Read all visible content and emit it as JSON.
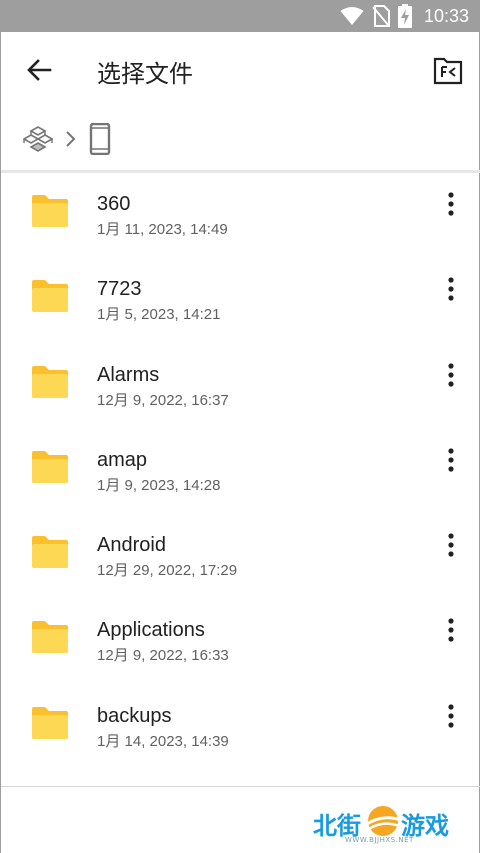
{
  "status_bar": {
    "time": "10:33",
    "icons": [
      "wifi-icon",
      "no-sim-icon",
      "battery-charging-icon"
    ]
  },
  "toolbar": {
    "back_icon": "arrow-back-icon",
    "title": "选择文件",
    "action_icon": "folder-select-icon"
  },
  "breadcrumb": {
    "items": [
      "root-storage-icon",
      "chevron-right-icon",
      "phone-icon"
    ]
  },
  "files": [
    {
      "name": "360",
      "date": "1月 11, 2023, 14:49"
    },
    {
      "name": "7723",
      "date": "1月 5, 2023, 14:21"
    },
    {
      "name": "Alarms",
      "date": "12月 9, 2022, 16:37"
    },
    {
      "name": "amap",
      "date": "1月 9, 2023, 14:28"
    },
    {
      "name": "Android",
      "date": "12月 29, 2022, 17:29"
    },
    {
      "name": "Applications",
      "date": "12月 9, 2022, 16:33"
    },
    {
      "name": "backups",
      "date": "1月 14, 2023, 14:39"
    }
  ],
  "colors": {
    "status_bar": "#9e9e9e",
    "folder": "#fbc02d",
    "folder_light": "#fdd855",
    "watermark_blue": "#1a9be0",
    "watermark_orange": "#f5a623"
  },
  "watermark": {
    "left": "北街",
    "right": "游戏",
    "sub": "WWW.BJJHXS.NET"
  }
}
